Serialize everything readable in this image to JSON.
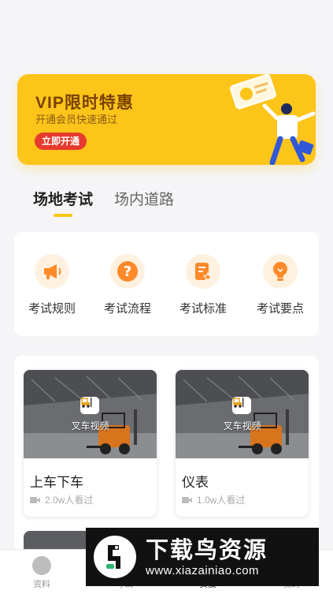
{
  "banner": {
    "title": "VIP限时特惠",
    "subtitle": "开通会员快速通过",
    "button": "立即开通"
  },
  "tabs": [
    {
      "label": "场地考试",
      "active": true
    },
    {
      "label": "场内道路",
      "active": false
    }
  ],
  "rules": [
    {
      "label": "考试规则",
      "icon": "megaphone-icon"
    },
    {
      "label": "考试流程",
      "icon": "question-icon"
    },
    {
      "label": "考试标准",
      "icon": "document-star-icon"
    },
    {
      "label": "考试要点",
      "icon": "lightbulb-icon"
    }
  ],
  "videos": [
    {
      "tag": "叉车视频",
      "title": "上车下车",
      "views": "2.0w人看过"
    },
    {
      "tag": "叉车视频",
      "title": "仪表",
      "views": "1.0w人看过"
    }
  ],
  "bottom_nav": [
    {
      "label": "资料",
      "active": false
    },
    {
      "label": "考试",
      "active": false
    },
    {
      "label": "实操",
      "active": true
    },
    {
      "label": "我的",
      "active": false
    }
  ],
  "watermark": {
    "main": "下载鸟资源",
    "url": "www.xiazainiao.com"
  },
  "colors": {
    "accent": "#fdc51a",
    "banner_button": "#e63b2e",
    "icon_orange": "#ff8a2a"
  }
}
